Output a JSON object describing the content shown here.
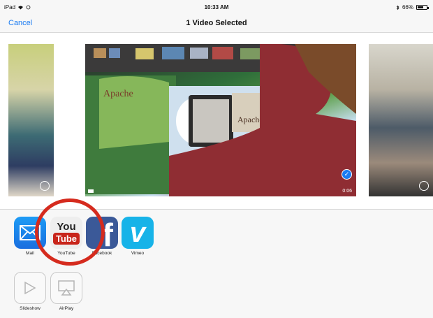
{
  "status": {
    "carrier": "iPad",
    "time": "10:33 AM",
    "battery": "66%",
    "battery_level": 0.66
  },
  "nav": {
    "cancel": "Cancel",
    "title": "1 Video Selected"
  },
  "video": {
    "duration": "0:06"
  },
  "share_apps": [
    {
      "label": "Mail",
      "icon": "mail-icon"
    },
    {
      "label": "YouTube",
      "icon": "youtube-icon",
      "logo_top": "You",
      "logo_bottom": "Tube"
    },
    {
      "label": "Facebook",
      "icon": "facebook-icon",
      "glyph": "f"
    },
    {
      "label": "Vimeo",
      "icon": "vimeo-icon",
      "glyph": "v"
    }
  ],
  "actions": [
    {
      "label": "Slideshow",
      "icon": "play-icon"
    },
    {
      "label": "AirPlay",
      "icon": "airplay-icon"
    }
  ],
  "colors": {
    "accent": "#1b7cf2",
    "annotation": "#d52b1e",
    "youtube": "#c8251b",
    "facebook": "#3b5998",
    "vimeo": "#17b3e8"
  }
}
